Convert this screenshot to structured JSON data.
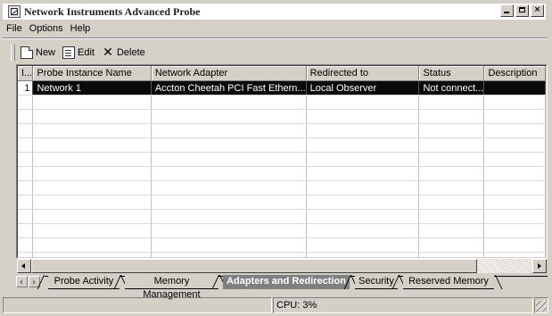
{
  "window": {
    "title": "Network Instruments Advanced Probe",
    "controls": {
      "minimize": "_",
      "maximize": "□",
      "close": "×"
    }
  },
  "menubar": {
    "items": [
      "File",
      "Options",
      "Help"
    ]
  },
  "toolbar": {
    "new_label": "New",
    "edit_label": "Edit",
    "delete_label": "Delete"
  },
  "table": {
    "columns": [
      "I...",
      "Probe Instance Name",
      "Network Adapter",
      "Redirected to",
      "Status",
      "Description"
    ],
    "rows": [
      {
        "index": "1",
        "name": "Network 1",
        "adapter": "Accton Cheetah PCI Fast Ethern...",
        "redirected": "Local Observer",
        "status": "Not connect...",
        "description": "",
        "selected": true
      }
    ]
  },
  "tabs": [
    "Probe Activity",
    "Memory Management",
    "Adapters and Redirection",
    "Security",
    "Reserved Memory"
  ],
  "active_tab": "Adapters and Redirection",
  "statusbar": {
    "left": "",
    "cpu": "CPU: 3%"
  }
}
